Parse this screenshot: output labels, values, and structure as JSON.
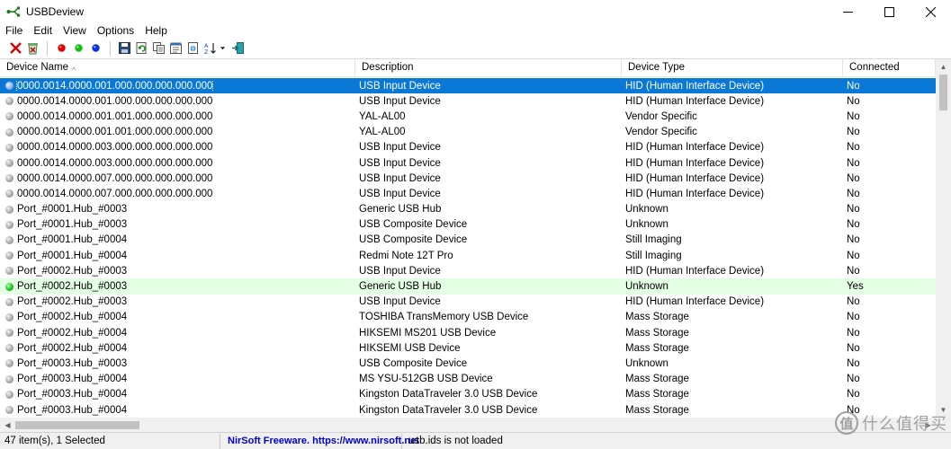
{
  "window": {
    "title": "USBDeview",
    "controls": {
      "minimize": "minimize",
      "maximize": "maximize",
      "close": "close"
    }
  },
  "menu": [
    "File",
    "Edit",
    "View",
    "Options",
    "Help"
  ],
  "toolbar": {
    "icons": [
      "delete-icon",
      "uninstall-icon",
      "red-dot-icon",
      "green-dot-icon",
      "blue-dot-icon",
      "save-icon",
      "refresh-icon",
      "copy-icon",
      "properties-icon",
      "html-report-icon",
      "sort-icon",
      "exit-icon"
    ]
  },
  "columns": [
    "Device Name",
    "Description",
    "Device Type",
    "Connected"
  ],
  "sort_indicator": "^",
  "rows": [
    {
      "name": "0000.0014.0000.001.000.000.000.000.000",
      "description": "USB Input Device",
      "type": "HID (Human Interface Device)",
      "connected": "No",
      "status": "blue",
      "selected": true
    },
    {
      "name": "0000.0014.0000.001.000.000.000.000.000",
      "description": "USB Input Device",
      "type": "HID (Human Interface Device)",
      "connected": "No",
      "status": "grey"
    },
    {
      "name": "0000.0014.0000.001.001.000.000.000.000",
      "description": "YAL-AL00",
      "type": "Vendor Specific",
      "connected": "No",
      "status": "grey"
    },
    {
      "name": "0000.0014.0000.001.001.000.000.000.000",
      "description": "YAL-AL00",
      "type": "Vendor Specific",
      "connected": "No",
      "status": "grey"
    },
    {
      "name": "0000.0014.0000.003.000.000.000.000.000",
      "description": "USB Input Device",
      "type": "HID (Human Interface Device)",
      "connected": "No",
      "status": "grey"
    },
    {
      "name": "0000.0014.0000.003.000.000.000.000.000",
      "description": "USB Input Device",
      "type": "HID (Human Interface Device)",
      "connected": "No",
      "status": "grey"
    },
    {
      "name": "0000.0014.0000.007.000.000.000.000.000",
      "description": "USB Input Device",
      "type": "HID (Human Interface Device)",
      "connected": "No",
      "status": "grey"
    },
    {
      "name": "0000.0014.0000.007.000.000.000.000.000",
      "description": "USB Input Device",
      "type": "HID (Human Interface Device)",
      "connected": "No",
      "status": "grey"
    },
    {
      "name": "Port_#0001.Hub_#0003",
      "description": "Generic USB Hub",
      "type": "Unknown",
      "connected": "No",
      "status": "grey"
    },
    {
      "name": "Port_#0001.Hub_#0003",
      "description": "USB Composite Device",
      "type": "Unknown",
      "connected": "No",
      "status": "grey"
    },
    {
      "name": "Port_#0001.Hub_#0004",
      "description": "USB Composite Device",
      "type": "Still Imaging",
      "connected": "No",
      "status": "grey"
    },
    {
      "name": "Port_#0001.Hub_#0004",
      "description": "Redmi Note 12T Pro",
      "type": "Still Imaging",
      "connected": "No",
      "status": "grey"
    },
    {
      "name": "Port_#0002.Hub_#0003",
      "description": "USB Input Device",
      "type": "HID (Human Interface Device)",
      "connected": "No",
      "status": "grey"
    },
    {
      "name": "Port_#0002.Hub_#0003",
      "description": "Generic USB Hub",
      "type": "Unknown",
      "connected": "Yes",
      "status": "green",
      "is_connected": true
    },
    {
      "name": "Port_#0002.Hub_#0003",
      "description": "USB Input Device",
      "type": "HID (Human Interface Device)",
      "connected": "No",
      "status": "grey"
    },
    {
      "name": "Port_#0002.Hub_#0004",
      "description": "TOSHIBA TransMemory USB Device",
      "type": "Mass Storage",
      "connected": "No",
      "status": "grey"
    },
    {
      "name": "Port_#0002.Hub_#0004",
      "description": "HIKSEMI MS201 USB Device",
      "type": "Mass Storage",
      "connected": "No",
      "status": "grey"
    },
    {
      "name": "Port_#0002.Hub_#0004",
      "description": "HIKSEMI USB Device",
      "type": "Mass Storage",
      "connected": "No",
      "status": "grey"
    },
    {
      "name": "Port_#0003.Hub_#0003",
      "description": "USB Composite Device",
      "type": "Unknown",
      "connected": "No",
      "status": "grey"
    },
    {
      "name": "Port_#0003.Hub_#0004",
      "description": "MS YSU-512GB USB Device",
      "type": "Mass Storage",
      "connected": "No",
      "status": "grey"
    },
    {
      "name": "Port_#0003.Hub_#0004",
      "description": "Kingston DataTraveler 3.0 USB Device",
      "type": "Mass Storage",
      "connected": "No",
      "status": "grey"
    },
    {
      "name": "Port_#0003.Hub_#0004",
      "description": "Kingston DataTraveler 3.0 USB Device",
      "type": "Mass Storage",
      "connected": "No",
      "status": "grey"
    }
  ],
  "statusbar": {
    "items_selected": "47 item(s), 1 Selected",
    "freeware_link": "NirSoft Freeware.  https://www.nirsoft.net",
    "usb_ids": "usb.ids is not loaded"
  },
  "watermark": {
    "logo_glyph": "值",
    "text": "什么值得买"
  },
  "colors": {
    "selection": "#0a78d7",
    "connected_row": "#e5ffe5",
    "link": "#0000cc"
  }
}
